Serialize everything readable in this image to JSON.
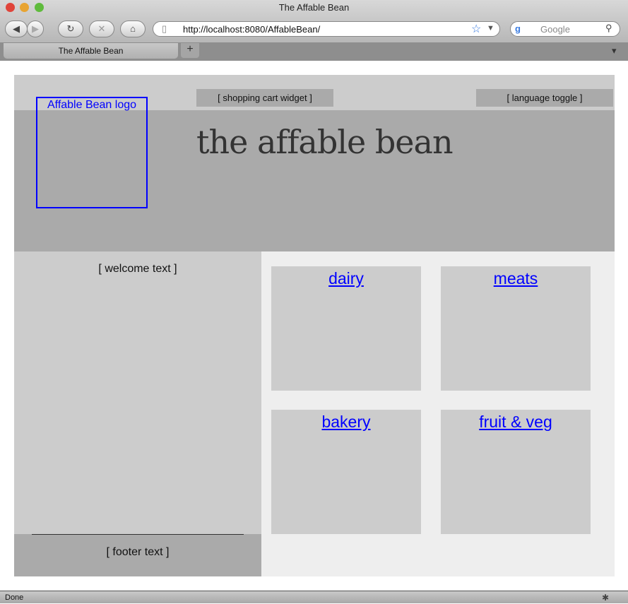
{
  "window": {
    "title": "The Affable Bean"
  },
  "toolbar": {
    "url": "http://localhost:8080/AffableBean/",
    "search_placeholder": "Google"
  },
  "tabs": [
    {
      "label": "The Affable Bean"
    }
  ],
  "new_tab_label": "+",
  "header": {
    "logo": "Affable Bean logo",
    "cart_widget": "[ shopping cart widget ]",
    "language_toggle": "[ language toggle ]",
    "title": "the affable bean"
  },
  "left": {
    "welcome": "[ welcome text ]",
    "footer": "[ footer text ]"
  },
  "categories": [
    {
      "label": "dairy"
    },
    {
      "label": "meats"
    },
    {
      "label": "bakery"
    },
    {
      "label": "fruit & veg"
    }
  ],
  "status": {
    "text": "Done"
  },
  "colors": {
    "link": "#0000ff",
    "header": "#aaaaaa",
    "panel": "#cccccc",
    "background": "#eeeeee"
  }
}
